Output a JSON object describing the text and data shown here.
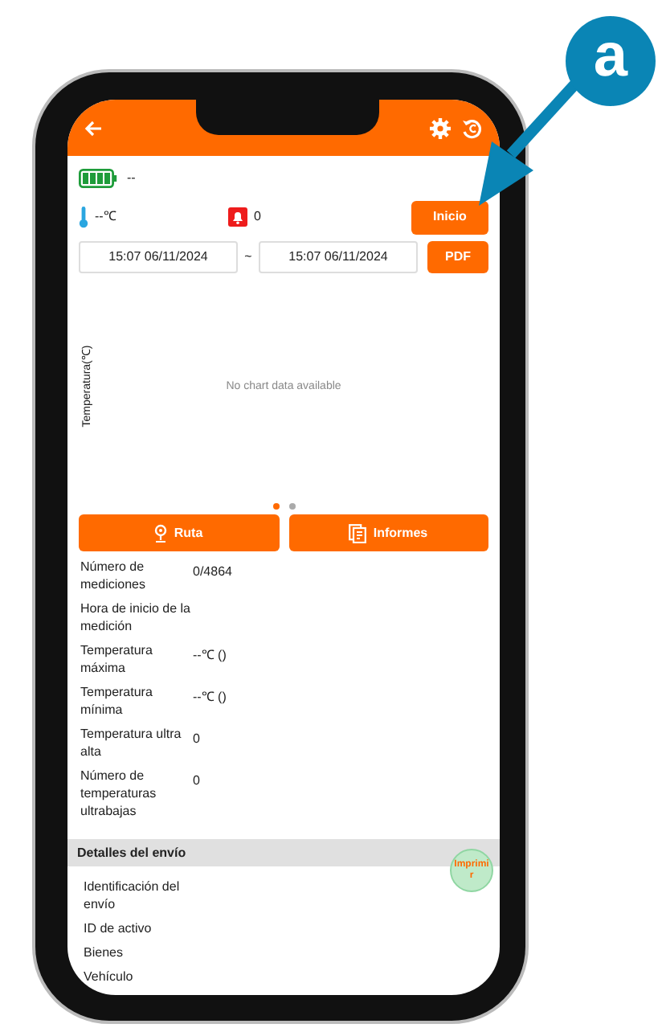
{
  "annotation": {
    "label": "a"
  },
  "status": {
    "battery_reading": "--",
    "temperature": "--℃",
    "alarm_count": "0",
    "start_button": "Inicio"
  },
  "date_range": {
    "from": "15:07 06/11/2024",
    "separator": "~",
    "to": "15:07 06/11/2024",
    "pdf_button": "PDF"
  },
  "chart": {
    "ylabel": "Temperatura(℃)",
    "empty_message": "No chart data available"
  },
  "pager": [
    {
      "selected": true
    },
    {
      "selected": false
    }
  ],
  "actions": [
    {
      "kind": "route",
      "label": "Ruta"
    },
    {
      "kind": "reports",
      "label": "Informes"
    }
  ],
  "measurements": [
    {
      "label": "Número de mediciones",
      "value": "0/4864"
    },
    {
      "label": "Hora de inicio de la medición"
    },
    {
      "label": "Temperatura máxima",
      "value": "--℃ ()"
    },
    {
      "label": "Temperatura mínima",
      "value": "--℃ ()"
    },
    {
      "label": "Temperatura ultra alta",
      "value": "0"
    },
    {
      "label": "Número de temperaturas ultrabajas",
      "value": "0"
    }
  ],
  "shipment": {
    "title": "Detalles del envío",
    "fields": [
      "Identificación del envío",
      "ID de activo",
      "Bienes",
      "Vehículo"
    ]
  },
  "print_button": "Imprimir"
}
